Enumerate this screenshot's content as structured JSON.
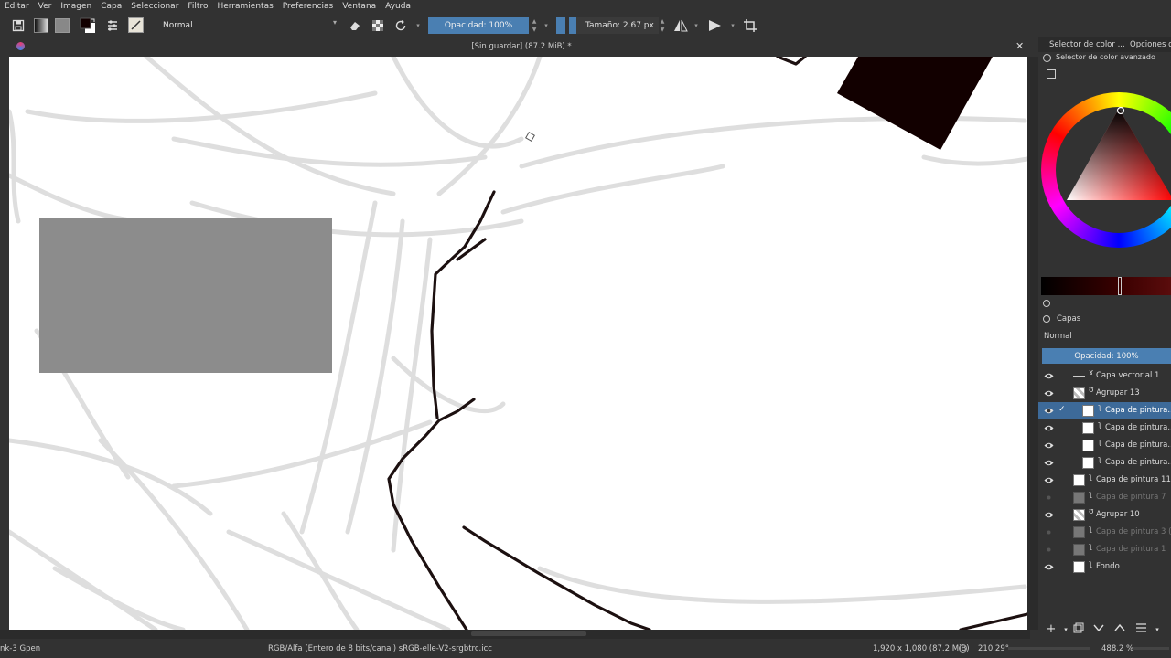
{
  "menu": [
    "Editar",
    "Ver",
    "Imagen",
    "Capa",
    "Seleccionar",
    "Filtro",
    "Herramientas",
    "Preferencias",
    "Ventana",
    "Ayuda"
  ],
  "toolbar": {
    "blend_mode": "Normal",
    "opacity_label": "Opacidad: 100%",
    "size_label": "Tamaño: 2.67 px"
  },
  "document": {
    "title": "[Sin guardar]  (87.2 MiB) *",
    "close_symbol": "✕"
  },
  "dock": {
    "tab_color": "Selector de color ...",
    "tab_options": "Opciones de",
    "advanced_selector": "Selector de color avanzado",
    "layers_title": "Capas",
    "layers_blend": "Normal",
    "layers_opacity": "Opacidad:  100%"
  },
  "layers": [
    {
      "name": "Capa vectorial 1",
      "visible": true,
      "indent": 0,
      "kind": "vector",
      "selected": false,
      "dim": false
    },
    {
      "name": "Agrupar 13",
      "visible": true,
      "indent": 0,
      "kind": "group",
      "selected": false,
      "dim": false
    },
    {
      "name": "Capa de pintura...",
      "visible": true,
      "indent": 1,
      "kind": "paint",
      "selected": true,
      "dim": false
    },
    {
      "name": "Capa de pintura...",
      "visible": true,
      "indent": 1,
      "kind": "paint",
      "selected": false,
      "dim": false
    },
    {
      "name": "Capa de pintura...",
      "visible": true,
      "indent": 1,
      "kind": "paint",
      "selected": false,
      "dim": false
    },
    {
      "name": "Capa de pintura...",
      "visible": true,
      "indent": 1,
      "kind": "paint",
      "selected": false,
      "dim": false
    },
    {
      "name": "Capa de pintura 11",
      "visible": true,
      "indent": 0,
      "kind": "paint",
      "selected": false,
      "dim": false
    },
    {
      "name": "Capa de pintura 7",
      "visible": false,
      "indent": 0,
      "kind": "paint",
      "selected": false,
      "dim": true
    },
    {
      "name": "Agrupar 10",
      "visible": true,
      "indent": 0,
      "kind": "group",
      "selected": false,
      "dim": false
    },
    {
      "name": "Capa de pintura 3 (...",
      "visible": false,
      "indent": 0,
      "kind": "paint",
      "selected": false,
      "dim": true
    },
    {
      "name": "Capa de pintura 1",
      "visible": false,
      "indent": 0,
      "kind": "paint",
      "selected": false,
      "dim": true
    },
    {
      "name": "Fondo",
      "visible": true,
      "indent": 0,
      "kind": "paint",
      "selected": false,
      "dim": false
    }
  ],
  "status": {
    "brush": "nk-3 Gpen",
    "colorspace": "RGB/Alfa (Entero de 8 bits/canal)  sRGB-elle-V2-srgbtrc.icc",
    "dimensions": "1,920 x 1,080 (87.2 MiB)",
    "rotation": "210.29°",
    "zoom": "488.2 %"
  },
  "colors": {
    "accent": "#4a7fb2",
    "panel": "#323232",
    "canvas": "#ffffff",
    "foreground": "#120000"
  }
}
